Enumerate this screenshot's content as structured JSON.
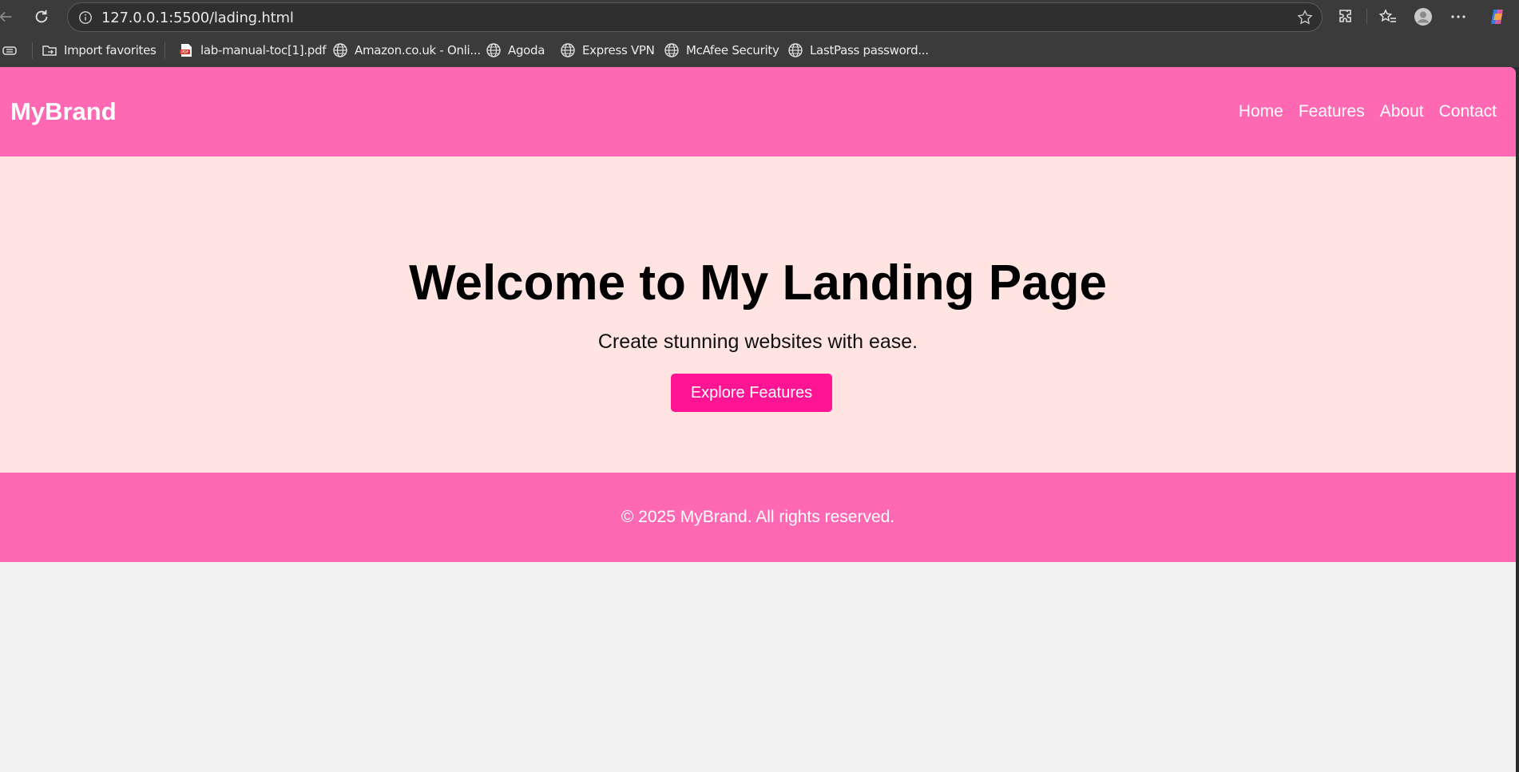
{
  "browser": {
    "url": "127.0.0.1:5500/lading.html",
    "bookmarks": [
      {
        "label": "Import favorites",
        "icon": "folder-icon"
      },
      {
        "label": "lab-manual-toc[1].pdf",
        "icon": "pdf-icon"
      },
      {
        "label": "Amazon.co.uk - Onli...",
        "icon": "globe-icon"
      },
      {
        "label": "Agoda",
        "icon": "globe-icon"
      },
      {
        "label": "Express VPN",
        "icon": "globe-icon"
      },
      {
        "label": "McAfee Security",
        "icon": "globe-icon"
      },
      {
        "label": "LastPass password...",
        "icon": "globe-icon"
      }
    ]
  },
  "site": {
    "brand": "MyBrand",
    "nav": [
      "Home",
      "Features",
      "About",
      "Contact"
    ],
    "hero": {
      "title": "Welcome to My Landing Page",
      "subtitle": "Create stunning websites with ease.",
      "cta_label": "Explore Features"
    },
    "footer": "© 2025 MyBrand. All rights reserved.",
    "colors": {
      "header_bg": "#ff69b4",
      "hero_bg": "#ffe4e1",
      "cta_bg": "#ff1493",
      "page_bg": "#f2f2f2"
    }
  }
}
